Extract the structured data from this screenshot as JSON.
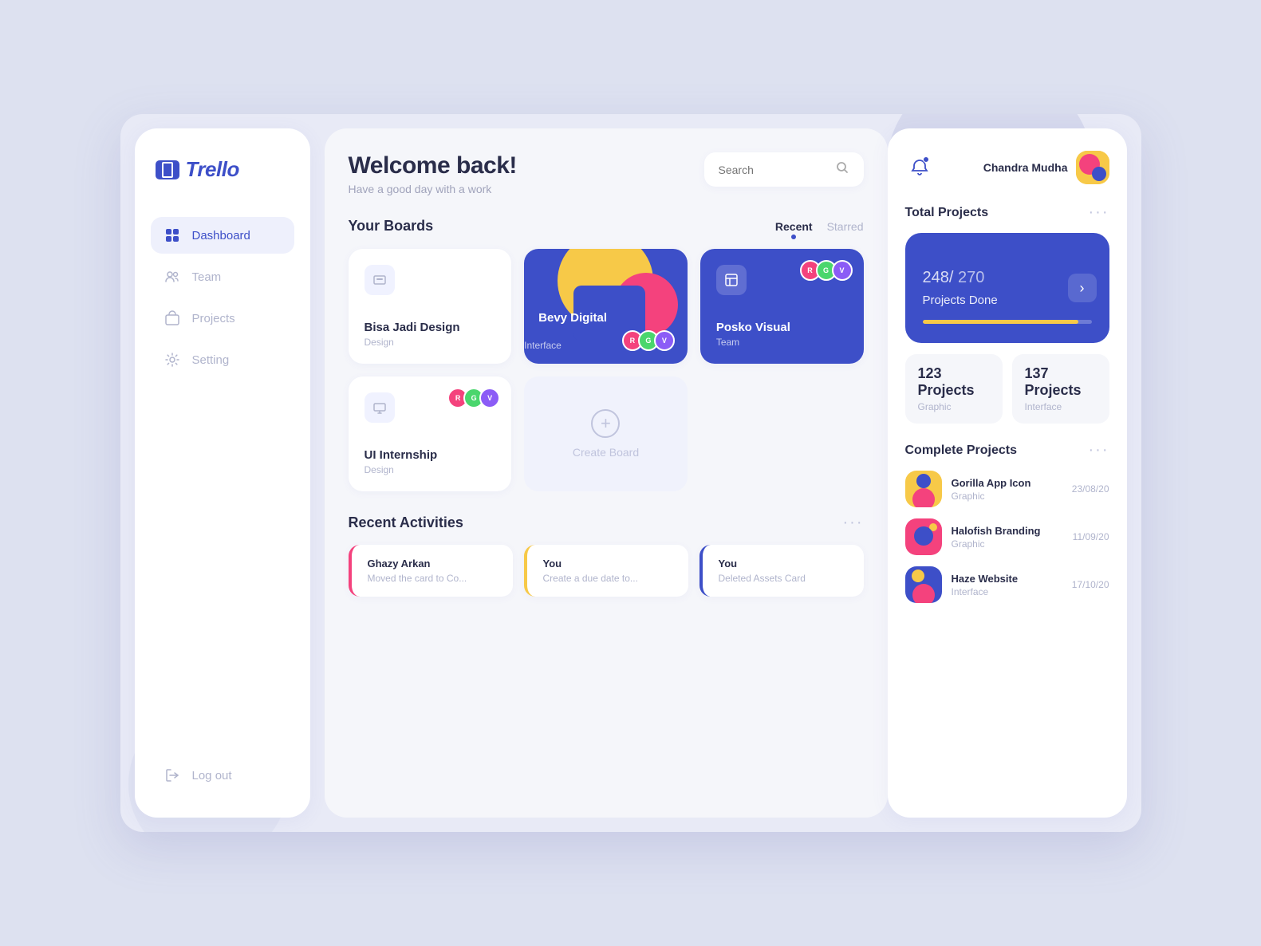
{
  "app": {
    "name": "Trello"
  },
  "sidebar": {
    "nav": [
      {
        "id": "dashboard",
        "label": "Dashboard",
        "icon": "📊",
        "active": true
      },
      {
        "id": "team",
        "label": "Team",
        "icon": "👥",
        "active": false
      },
      {
        "id": "projects",
        "label": "Projects",
        "icon": "💼",
        "active": false
      },
      {
        "id": "setting",
        "label": "Setting",
        "icon": "⚙️",
        "active": false
      }
    ],
    "logout_label": "Log out"
  },
  "header": {
    "welcome_title": "Welcome back!",
    "welcome_subtitle": "Have a good day with a work",
    "search_placeholder": "Search"
  },
  "boards": {
    "title": "Your Boards",
    "tabs": [
      {
        "label": "Recent",
        "active": true
      },
      {
        "label": "Starred",
        "active": false
      }
    ],
    "items": [
      {
        "id": "bisa-jadi",
        "label": "Bisa Jadi Design",
        "sublabel": "Design",
        "featured": false
      },
      {
        "id": "bevy-digital",
        "label": "Bevy Digital",
        "sublabel": "Interface",
        "featured": true
      },
      {
        "id": "posko-visual",
        "label": "Posko Visual",
        "sublabel": "Team",
        "featured": false,
        "purple": true
      },
      {
        "id": "ui-internship",
        "label": "UI Internship",
        "sublabel": "Design",
        "featured": false
      },
      {
        "id": "create-board",
        "label": "Create Board",
        "is_create": true
      }
    ]
  },
  "activities": {
    "title": "Recent Activities",
    "items": [
      {
        "name": "Ghazy Arkan",
        "desc": "Moved the card to Co...",
        "color": "pink"
      },
      {
        "name": "You",
        "desc": "Create a due date to...",
        "color": "yellow"
      },
      {
        "name": "You",
        "desc": "Deleted Assets Card",
        "color": "blue"
      }
    ]
  },
  "right_panel": {
    "user_name": "Chandra Mudha",
    "total_projects": {
      "title": "Total Projects",
      "count": "248",
      "total": "270",
      "label": "Projects Done",
      "progress_percent": 92
    },
    "sub_projects": [
      {
        "count": "123 Projects",
        "label": "Graphic"
      },
      {
        "count": "137 Projects",
        "label": "Interface"
      }
    ],
    "complete_projects": {
      "title": "Complete Projects",
      "items": [
        {
          "name": "Gorilla App Icon",
          "type": "Graphic",
          "date": "23/08/20"
        },
        {
          "name": "Halofish Branding",
          "type": "Graphic",
          "date": "11/09/20"
        },
        {
          "name": "Haze Website",
          "type": "Interface",
          "date": "17/10/20"
        }
      ]
    }
  }
}
